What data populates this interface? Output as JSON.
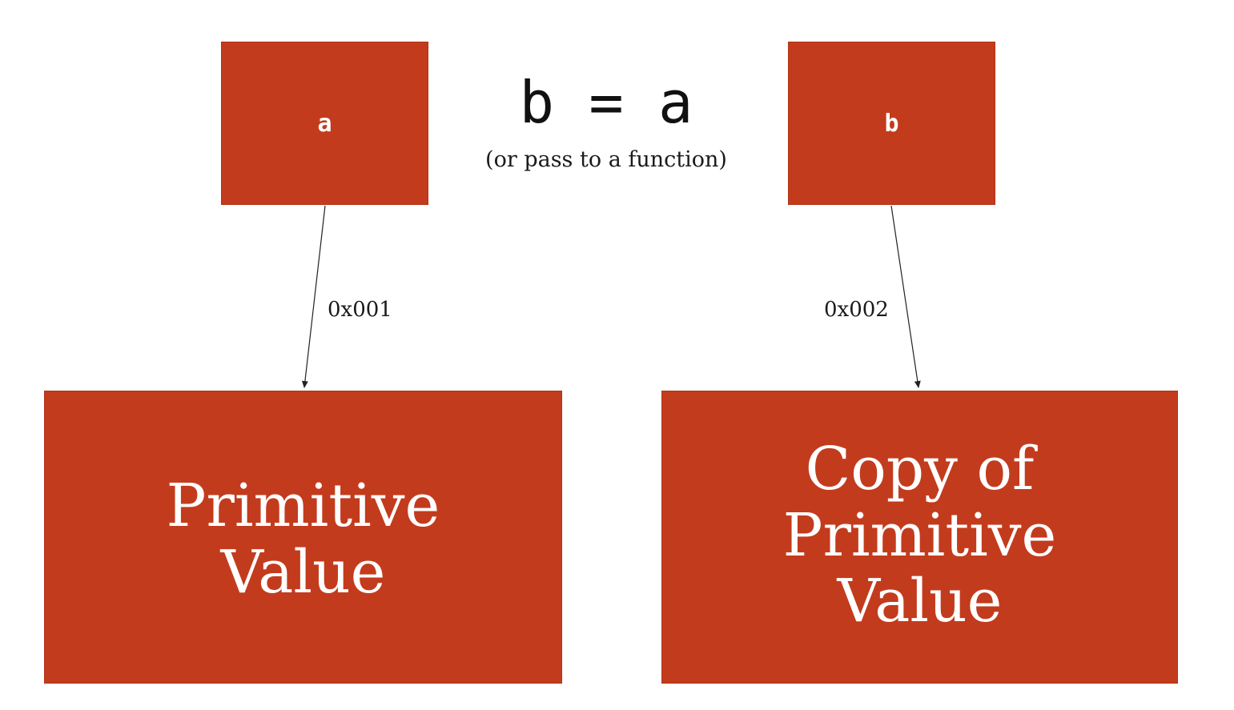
{
  "diagram": {
    "variables": {
      "a": {
        "label": "a"
      },
      "b": {
        "label": "b"
      }
    },
    "assignment": {
      "expression": "b = a",
      "note": "(or pass to a function)"
    },
    "values": {
      "original": {
        "label": "Primitive\nValue"
      },
      "copy": {
        "label": "Copy of\nPrimitive\nValue"
      }
    },
    "addresses": {
      "a": "0x001",
      "b": "0x002"
    },
    "colors": {
      "box_fill": "#c33b1d",
      "box_text": "#ffffff",
      "line": "#222222"
    }
  }
}
